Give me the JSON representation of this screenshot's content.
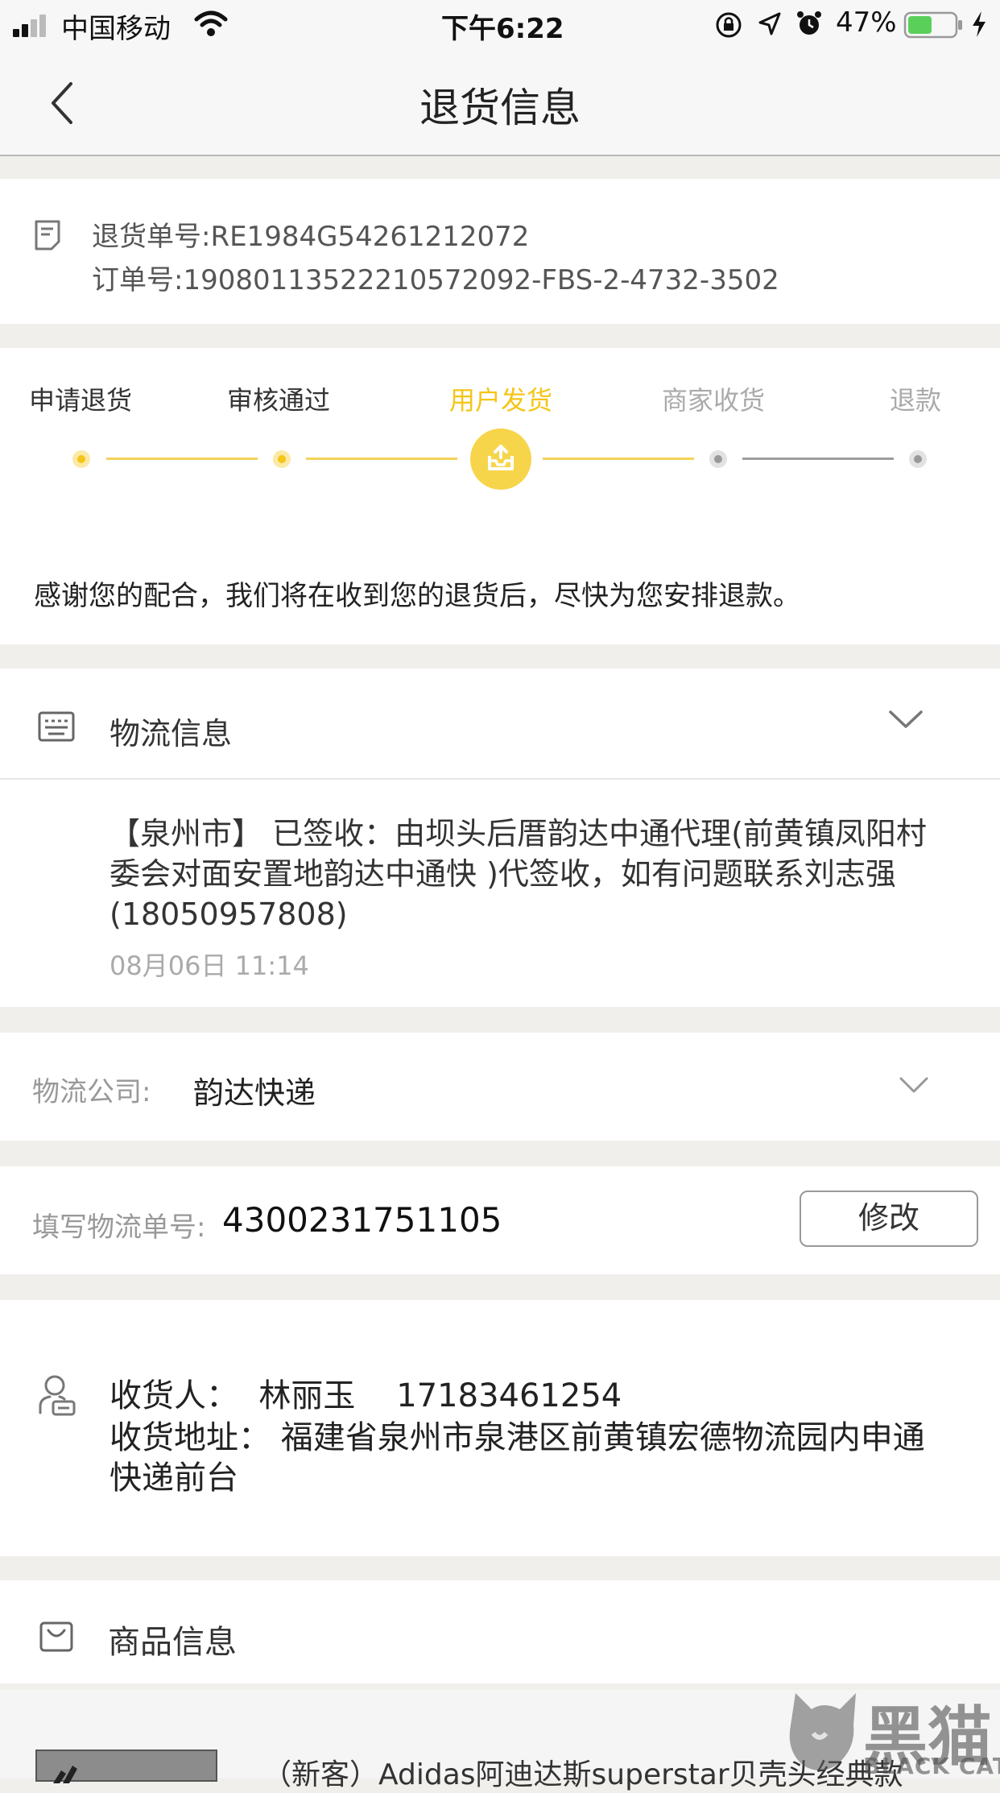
{
  "status_bar": {
    "carrier": "中国移动",
    "time": "下午6:22",
    "battery": "47%"
  },
  "nav": {
    "title": "退货信息"
  },
  "order": {
    "return_no": "退货单号:RE1984G54261212072",
    "order_no": "订单号:190801135222105720​92-FBS-2-4732-3502"
  },
  "progress": {
    "steps": [
      "申请退货",
      "审核通过",
      "用户发货",
      "商家收货",
      "退款"
    ],
    "current_index": 2,
    "message": "感谢您的配合，我们将在收到您的退货后，尽快为您安排退款。",
    "colors": {
      "active": "#f5c518",
      "active_text": "#f5c518",
      "inactive": "#b5b5b5",
      "line_active": "#f3d25a",
      "line_inactive": "#9e9e9e"
    }
  },
  "logistics": {
    "header": "物流信息",
    "detail": "【泉州市】 已签收：由坝头后厝韵达中通代理(前黄镇凤阳村委会对面安置地韵达中通快 )代签收，如有问题联系刘志强(18050957808)",
    "time": "08月06日 11:14"
  },
  "company": {
    "label": "物流公司:",
    "value": "韵达快递"
  },
  "tracking": {
    "label": "填写物流单号:",
    "value": "4300231751105",
    "modify_button": "修改"
  },
  "receiver": {
    "name_line": "收货人：  林丽玉    17183461254",
    "address_line": "收货地址：  福建省泉州市泉港区前黄镇宏德物流园内申通快递前台"
  },
  "goods": {
    "header": "商品信息",
    "item_title": "（新客）Adidas阿迪达斯superstar贝壳头经典款"
  },
  "watermark": {
    "text_cn": "黑猫",
    "text_en": "BLACK CAT"
  }
}
